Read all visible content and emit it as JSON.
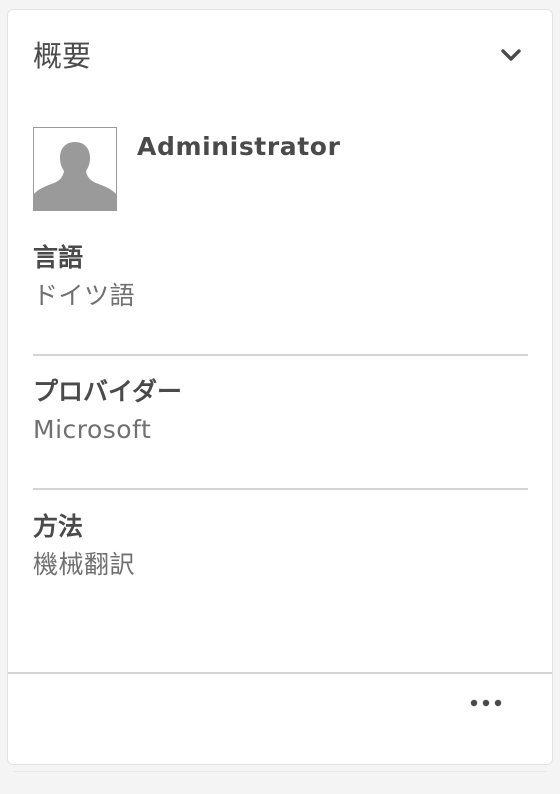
{
  "card": {
    "title": "概要",
    "collapse_icon": "chevron-down-icon",
    "more_icon": "more-horizontal-icon"
  },
  "user": {
    "name": "Administrator",
    "avatar_icon": "user-silhouette-icon"
  },
  "fields": [
    {
      "label": "言語",
      "value": "ドイツ語"
    },
    {
      "label": "プロバイダー",
      "value": "Microsoft"
    },
    {
      "label": "方法",
      "value": "機械翻訳"
    }
  ],
  "colors": {
    "text_dark": "#4a4a4a",
    "text_muted": "#707070",
    "divider": "#d4d4d4",
    "avatar_fill": "#9a9a9a"
  }
}
